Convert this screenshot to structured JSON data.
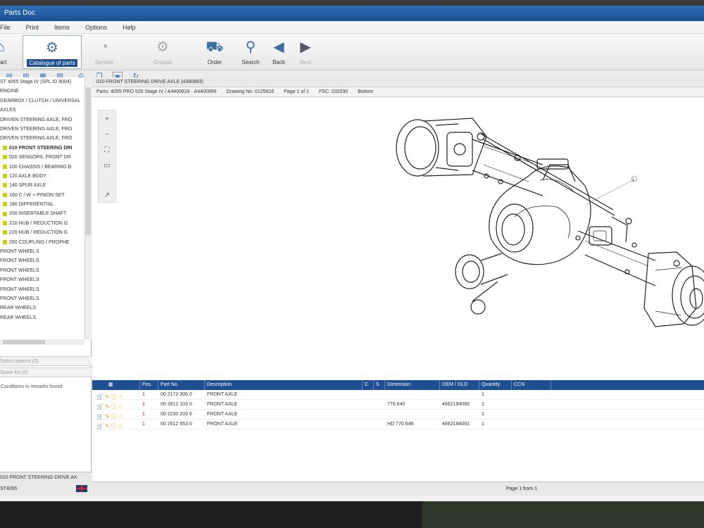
{
  "window": {
    "title": "Parts Doc"
  },
  "menu": [
    "File",
    "Print",
    "Items",
    "Options",
    "Help"
  ],
  "toolbar": [
    {
      "label": "Start",
      "icon": "home-icon",
      "state": "normal"
    },
    {
      "label": "Catalogue of parts",
      "icon": "parts-catalogue-icon",
      "state": "active"
    },
    {
      "label": "Service",
      "icon": "stopwatch-icon",
      "state": "disabled"
    },
    {
      "label": "Groups",
      "icon": "gears-icon",
      "state": "disabled"
    },
    {
      "label": "Order",
      "icon": "cart-icon",
      "state": "normal"
    },
    {
      "label": "Search",
      "icon": "magnifier-icon",
      "state": "normal"
    },
    {
      "label": "Back",
      "icon": "back-arrow-icon",
      "state": "normal"
    },
    {
      "label": "Next",
      "icon": "forward-arrow-icon",
      "state": "disabled"
    }
  ],
  "tree": {
    "items": [
      {
        "text": "ST 4055 Stage IV (SPL ID 9004)",
        "level": 1
      },
      {
        "text": "ENGINE",
        "level": 1
      },
      {
        "text": "GEARBOX / CLUTCH / UNIVERSAL",
        "level": 1
      },
      {
        "text": "AXLES",
        "level": 1
      },
      {
        "text": "DRIVEN STEERING AXLE, FRO",
        "level": 1
      },
      {
        "text": "DRIVEN STEERING AXLE, FRO",
        "level": 1
      },
      {
        "text": "DRIVEN STEERING AXLE, FRO",
        "level": 1
      },
      {
        "text": "010 FRONT STEERING DRI",
        "level": 2,
        "selected": true
      },
      {
        "text": "020 SENSORS, FRONT DR",
        "level": 2
      },
      {
        "text": "100 CHASSIS / BEARING B",
        "level": 2
      },
      {
        "text": "120 AXLE BODY",
        "level": 2
      },
      {
        "text": "140 SPUR AXLE",
        "level": 2
      },
      {
        "text": "160 C / W + PINION SET",
        "level": 2
      },
      {
        "text": "180 DIFFERENTIAL",
        "level": 2
      },
      {
        "text": "200 INSERTABLE SHAFT",
        "level": 2
      },
      {
        "text": "210 HUB / REDUCTION G",
        "level": 2
      },
      {
        "text": "220 HUB / REDUCTION G",
        "level": 2
      },
      {
        "text": "260 COUPLING / PROPHE",
        "level": 2
      },
      {
        "text": "FRONT WHEELS",
        "level": 1
      },
      {
        "text": "FRONT WHEELS",
        "level": 1
      },
      {
        "text": "FRONT WHEELS",
        "level": 1
      },
      {
        "text": "FRONT WHEELS",
        "level": 1
      },
      {
        "text": "FRONT WHEELS",
        "level": 1
      },
      {
        "text": "FRONT WHEELS",
        "level": 1
      },
      {
        "text": "REAR WHEELS",
        "level": 1
      },
      {
        "text": "REAR WHEELS",
        "level": 1
      }
    ]
  },
  "left_panels": {
    "header1": "Select options (0)",
    "header2": "Spare list (0)",
    "note": "Conditions in remarks found"
  },
  "left_footer": {
    "line1": "010 FRONT STEERING DRIVE AX",
    "line2": "ST4055"
  },
  "group_title": "010 FRONT STEERING DRIVE AXLE (4380883)",
  "info": {
    "parts": "Parts: 4055 PRO 520 Stage IV / A4400818 - A4400999",
    "drawing": "Drawing No: 0125816",
    "page": "Page 1 of 1",
    "ref": "FSC: 032030",
    "bottom": "Bottom"
  },
  "table": {
    "headers": [
      "Pos.",
      "Part No.",
      "Description",
      "C",
      "S",
      "Dimension",
      "OEM / OLD",
      "Quantity",
      "CCN"
    ],
    "rows": [
      {
        "pos": "1",
        "part": "00 2172 306 0",
        "desc": "FRONT AXLE",
        "dim": "",
        "oem": "",
        "qty": "1"
      },
      {
        "pos": "1",
        "part": "00 2612 103 0",
        "desc": "FRONT AXLE",
        "dim": "770.640",
        "oem": "4662194095",
        "qty": "1"
      },
      {
        "pos": "1",
        "part": "00 2230 203 0",
        "desc": "FRONT AXLE",
        "dim": "",
        "oem": "",
        "qty": "1"
      },
      {
        "pos": "1",
        "part": "00 2612 953 0",
        "desc": "FRONT AXLE",
        "dim": "HD 770.646",
        "oem": "4662194092",
        "qty": "1"
      }
    ]
  },
  "status": {
    "page": "Page 1 from 1"
  },
  "callout_label": "1"
}
